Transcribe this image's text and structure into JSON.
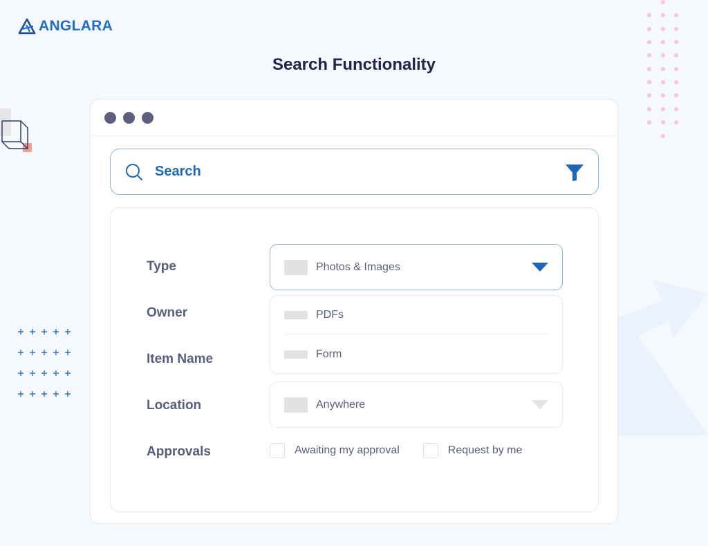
{
  "brand": {
    "name": "ANGLARA",
    "color": "#1f6ec4"
  },
  "page": {
    "title": "Search Functionality"
  },
  "window": {
    "controls": [
      "dot",
      "dot",
      "dot"
    ]
  },
  "search": {
    "placeholder": "Search",
    "icon": "search-icon",
    "filter_icon": "filter-icon",
    "accent_color": "#1e67b7"
  },
  "form": {
    "labels": {
      "type": "Type",
      "owner": "Owner",
      "item_name": "Item Name",
      "location": "Location",
      "approvals": "Approvals"
    },
    "type_select": {
      "selected": "Photos & Images",
      "options": [
        "PDFs",
        "Form"
      ],
      "expanded": true
    },
    "location_select": {
      "selected": "Anywhere"
    },
    "approvals": [
      {
        "label": "Awaiting my approval",
        "checked": false
      },
      {
        "label": "Request by me",
        "checked": false
      }
    ]
  }
}
